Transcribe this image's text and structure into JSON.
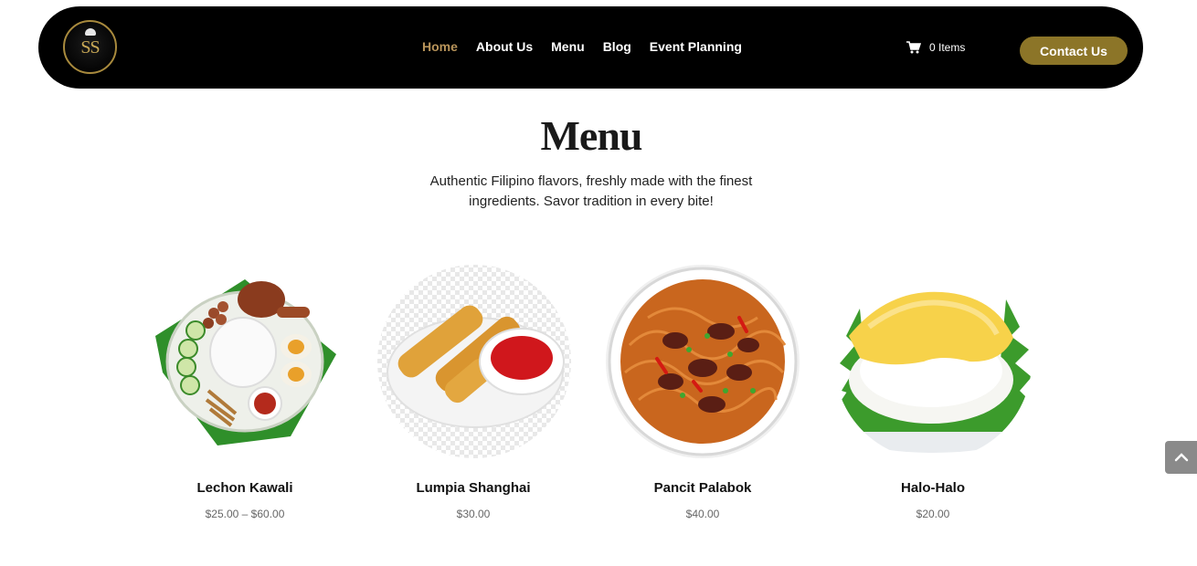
{
  "header": {
    "logo_text": "SS",
    "nav": [
      {
        "label": "Home",
        "active": true
      },
      {
        "label": "About Us",
        "active": false
      },
      {
        "label": "Menu",
        "active": false
      },
      {
        "label": "Blog",
        "active": false
      },
      {
        "label": "Event Planning",
        "active": false
      }
    ],
    "cart_label": "0 Items",
    "contact_label": "Contact Us"
  },
  "main": {
    "title": "Menu",
    "subtitle_line1": "Authentic Filipino flavors, freshly made with the finest",
    "subtitle_line2": "ingredients. Savor tradition in every bite!",
    "items": [
      {
        "name": "Lechon Kawali",
        "price": "$25.00 – $60.00",
        "icon": "rice-plate-icon"
      },
      {
        "name": "Lumpia Shanghai",
        "price": "$30.00",
        "icon": "spring-rolls-icon"
      },
      {
        "name": "Pancit Palabok",
        "price": "$40.00",
        "icon": "noodle-bowl-icon"
      },
      {
        "name": "Halo-Halo",
        "price": "$20.00",
        "icon": "dessert-plate-icon"
      }
    ]
  },
  "colors": {
    "header_bg": "#000000",
    "accent": "#b8945a",
    "button": "#8c7528"
  },
  "scroll_top_icon": "chevron-up-icon"
}
